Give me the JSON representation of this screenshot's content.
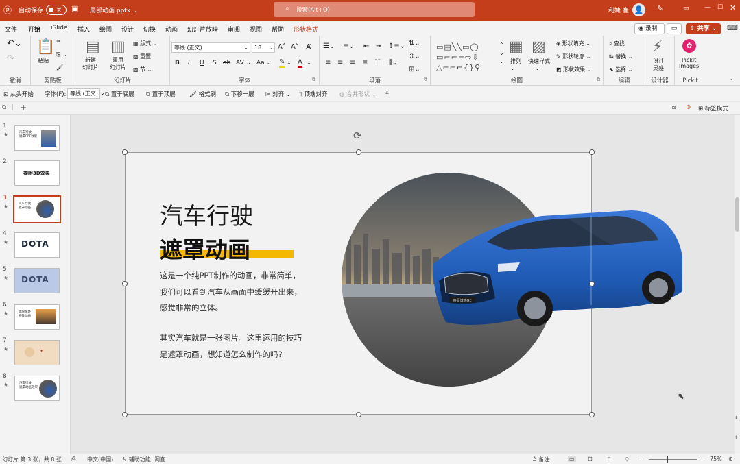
{
  "titlebar": {
    "autosave_label": "自动保存",
    "autosave_state": "关",
    "filename": "局部动画.pptx",
    "search_placeholder": "搜索(Alt+Q)",
    "user_name": "利婕 崔"
  },
  "menu_tabs": [
    "文件",
    "开始",
    "iSlide",
    "插入",
    "绘图",
    "设计",
    "切换",
    "动画",
    "幻灯片放映",
    "审阅",
    "视图",
    "帮助",
    "形状格式"
  ],
  "menu_right": {
    "record": "录制",
    "share": "共享"
  },
  "ribbon": {
    "undo_group": "撤消",
    "clipboard": {
      "label": "剪贴板",
      "paste": "粘贴"
    },
    "slides": {
      "label": "幻灯片",
      "new_slide": "新建\n幻灯片",
      "reuse_slide": "重用\n幻灯片",
      "layout": "版式",
      "reset": "重置",
      "section": "节"
    },
    "font": {
      "label": "字体",
      "name": "等线 (正文)",
      "size": "18",
      "bold": "B",
      "italic": "I",
      "underline": "U",
      "strike": "S",
      "spacing": "AV",
      "case": "Aa"
    },
    "paragraph": {
      "label": "段落"
    },
    "drawing": {
      "label": "绘图",
      "arrange": "排列",
      "quick_styles": "快速样式",
      "fill": "形状填充",
      "outline": "形状轮廓",
      "effects": "形状效果"
    },
    "editing": {
      "label": "编辑",
      "find": "查找",
      "replace": "替换",
      "select": "选择"
    },
    "designer": {
      "label": "设计器",
      "btn": "设计\n灵感"
    },
    "pickit": {
      "label": "Pickit",
      "btn": "Pickit\nImages"
    }
  },
  "quickbar": {
    "from_start": "从头开始",
    "font_label": "字体(F):",
    "font_value": "等线 (正文",
    "send_back": "置于底层",
    "bring_front": "置于顶层",
    "format_painter": "格式刷",
    "move_down": "下移一层",
    "align": "对齐",
    "align_top": "顶端对齐",
    "merge_shapes": "合并形状"
  },
  "tag_mode": "标签模式",
  "thumbnails": [
    {
      "num": "1",
      "star": "★",
      "text": "汽车行驶\n遮罩PPT效果"
    },
    {
      "num": "2",
      "star": "",
      "text": "裸眼3D效果"
    },
    {
      "num": "3",
      "star": "★",
      "text": "汽车行驶\n遮罩动画"
    },
    {
      "num": "4",
      "star": "★",
      "text": "DOTA"
    },
    {
      "num": "5",
      "star": "★",
      "text": "DOTA"
    },
    {
      "num": "6",
      "star": "★",
      "text": "无限循环\n特效动画"
    },
    {
      "num": "7",
      "star": "★",
      "text": ""
    },
    {
      "num": "8",
      "star": "★",
      "text": "汽车行驶\n遮罩动画效果"
    }
  ],
  "slide": {
    "title_line1": "汽车行驶",
    "title_line2": "遮罩动画",
    "para1": "这是一个纯PPT制作的动画，非常简单，我们可以看到汽车从画面中缓缓开出来，感觉非常的立体。",
    "para2": "其实汽车就是一张图片。这里运用的技巧是遮罩动画，想知道怎么制作的吗?",
    "plate_text": "帝豪博瑞GE",
    "accent_color": "#f5b800",
    "car_color": "#1f5bb5"
  },
  "status": {
    "slide_info": "幻灯片 第 3 张，共 8 张",
    "language": "中文(中国)",
    "accessibility": "辅助功能: 调查",
    "notes": "备注",
    "zoom": "75%"
  }
}
